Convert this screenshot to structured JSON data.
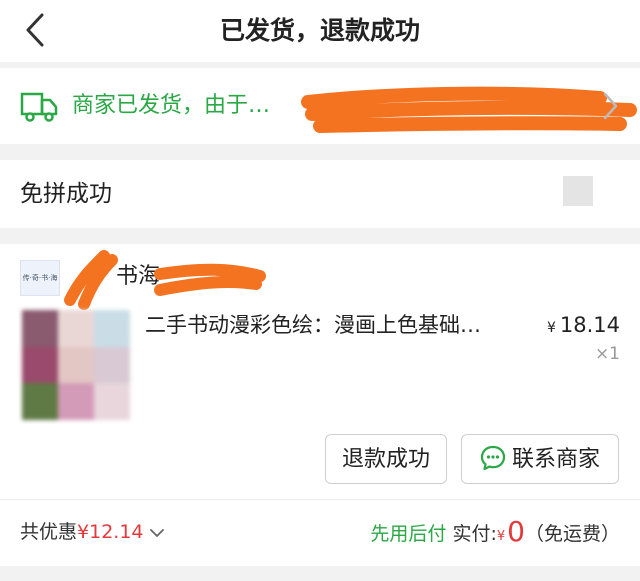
{
  "header": {
    "title": "已发货，退款成功"
  },
  "shipping": {
    "text": "商家已发货，由于…"
  },
  "group": {
    "label": "免拼成功"
  },
  "order": {
    "shop_logo_text": "传·奇·书·海",
    "shop_name": "书海_",
    "product_name": "二手书动漫彩色绘：漫画上色基础…",
    "currency": "¥",
    "price": "18.14",
    "quantity": "×1",
    "buttons": {
      "refund": "退款成功",
      "contact": "联系商家"
    }
  },
  "footer": {
    "discount_label": "共优惠",
    "discount_amount": "¥12.14",
    "pay_later": "先用后付",
    "paid_label": "实付:",
    "currency": "¥",
    "paid_amount": "0",
    "shipping_note": "（免运费）"
  },
  "colors": {
    "accent_green": "#2aa845",
    "price_red": "#e5383b",
    "redaction": "#f47321"
  },
  "thumbnail_colors": [
    "#8a5a6f",
    "#e9d7d5",
    "#c9dde6",
    "#9a4a6c",
    "#e3c7c4",
    "#d8c9d4",
    "#5f7a45",
    "#d39bb7",
    "#e8d6dc"
  ]
}
